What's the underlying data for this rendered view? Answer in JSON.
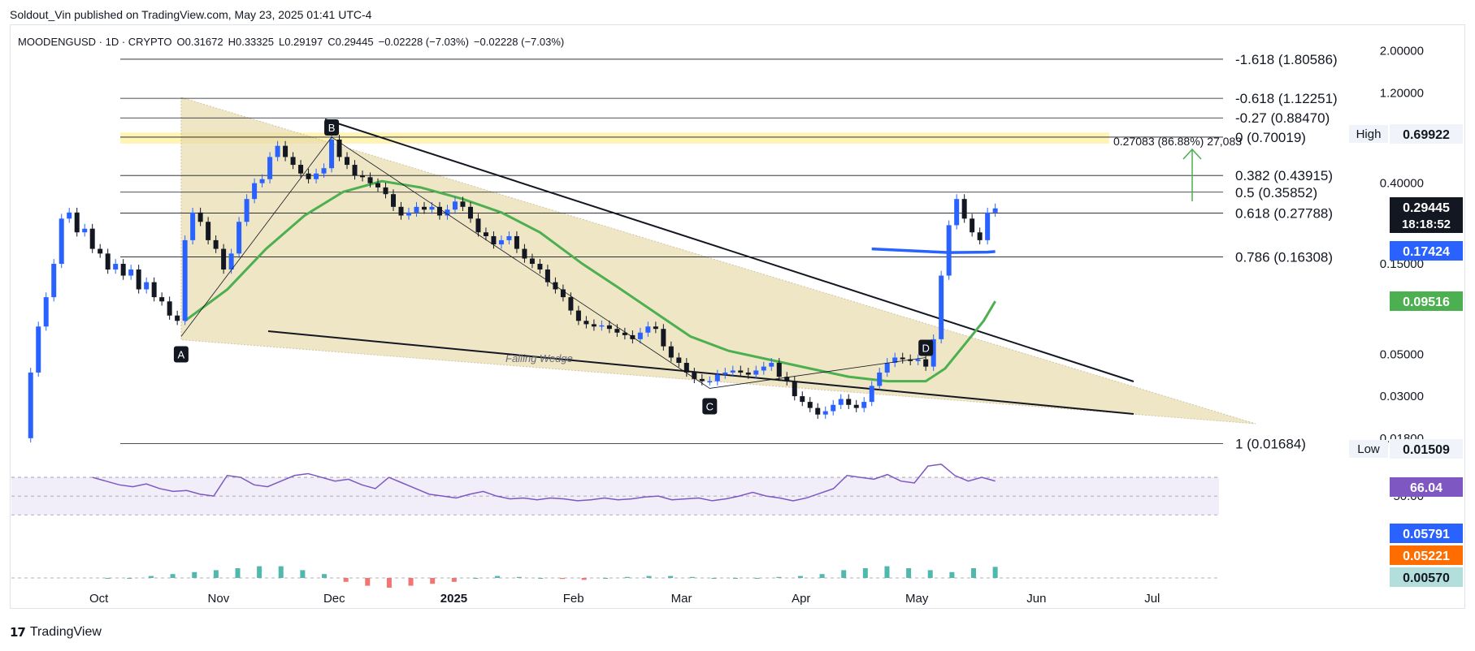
{
  "header": {
    "publisher_line": "Soldout_Vin published on TradingView.com, May 23, 2025 01:41 UTC-4"
  },
  "symbol_bar": {
    "symbol": "MOODENGUSD · 1D · CRYPTO",
    "open": "O0.31672",
    "high": "H0.33325",
    "low": "L0.29197",
    "close": "C0.29445",
    "change": "−0.02228 (−7.03%)",
    "change2": "−0.02228 (−7.03%)"
  },
  "footer": {
    "brand": "TradingView"
  },
  "colors": {
    "up_candle": "#2962ff",
    "down_candle": "#131722",
    "wedge_fill": "#e8d9a8",
    "ema_green": "#4caf50",
    "ema_blue": "#2962ff",
    "rsi_line": "#7e57c2",
    "macd_line": "#2962ff",
    "signal_line": "#ff6d00",
    "highlight_band": "#fff2a8"
  },
  "chart_data": [
    {
      "type": "candlestick",
      "scale": "log",
      "y_tick_labels": [
        "2.00000",
        "1.20000",
        "0.40000",
        "0.15000",
        "0.05000",
        "0.03000",
        "0.01800"
      ],
      "x_tick_labels": [
        "Oct",
        "Nov",
        "Dec",
        "2025",
        "Feb",
        "Mar",
        "Apr",
        "May",
        "Jun",
        "Jul"
      ],
      "ylim": [
        0.0155,
        2.5
      ],
      "fibonacci_levels": [
        {
          "label": "-1.618 (1.80586)",
          "value": 1.80586
        },
        {
          "label": "-0.618 (1.12251)",
          "value": 1.12251
        },
        {
          "label": "-0.27 (0.88470)",
          "value": 0.8847
        },
        {
          "label": "0 (0.70019)",
          "value": 0.70019
        },
        {
          "label": "0.382 (0.43915)",
          "value": 0.43915
        },
        {
          "label": "0.5 (0.35852)",
          "value": 0.35852
        },
        {
          "label": "0.618 (0.27788)",
          "value": 0.27788
        },
        {
          "label": "0.786 (0.16308)",
          "value": 0.16308
        },
        {
          "label": "1 (0.01684)",
          "value": 0.01684
        }
      ],
      "target_label": "0.27083 (86.88%) 27,083",
      "pattern_points": [
        {
          "label": "A",
          "date": "2024-10-24",
          "value": 0.062
        },
        {
          "label": "B",
          "date": "2024-12-02",
          "value": 0.7
        },
        {
          "label": "C",
          "date": "2025-03-10",
          "value": 0.033
        },
        {
          "label": "D",
          "date": "2025-05-05",
          "value": 0.048
        }
      ],
      "annotation": "Falling Wedge",
      "price_badges": [
        {
          "label": "High",
          "value": "0.69922"
        },
        {
          "label": "Low",
          "value": "0.01509"
        },
        {
          "label": "last",
          "value": "0.29445",
          "countdown": "18:18:52"
        },
        {
          "label": "ema_blue",
          "value": "0.17424"
        },
        {
          "label": "ema_green",
          "value": "0.09516"
        }
      ],
      "close_series": [
        [
          "2024-09-13",
          0.018
        ],
        [
          "2024-09-15",
          0.04
        ],
        [
          "2024-09-17",
          0.07
        ],
        [
          "2024-09-19",
          0.1
        ],
        [
          "2024-09-21",
          0.15
        ],
        [
          "2024-09-23",
          0.26
        ],
        [
          "2024-09-25",
          0.28
        ],
        [
          "2024-09-27",
          0.22
        ],
        [
          "2024-09-29",
          0.23
        ],
        [
          "2024-10-01",
          0.18
        ],
        [
          "2024-10-03",
          0.17
        ],
        [
          "2024-10-05",
          0.14
        ],
        [
          "2024-10-07",
          0.15
        ],
        [
          "2024-10-09",
          0.13
        ],
        [
          "2024-10-11",
          0.14
        ],
        [
          "2024-10-13",
          0.11
        ],
        [
          "2024-10-15",
          0.12
        ],
        [
          "2024-10-17",
          0.1
        ],
        [
          "2024-10-19",
          0.095
        ],
        [
          "2024-10-21",
          0.08
        ],
        [
          "2024-10-23",
          0.075
        ],
        [
          "2024-10-25",
          0.2
        ],
        [
          "2024-10-27",
          0.28
        ],
        [
          "2024-10-29",
          0.25
        ],
        [
          "2024-10-31",
          0.2
        ],
        [
          "2024-11-02",
          0.18
        ],
        [
          "2024-11-04",
          0.14
        ],
        [
          "2024-11-06",
          0.17
        ],
        [
          "2024-11-08",
          0.25
        ],
        [
          "2024-11-10",
          0.33
        ],
        [
          "2024-11-12",
          0.4
        ],
        [
          "2024-11-14",
          0.42
        ],
        [
          "2024-11-16",
          0.55
        ],
        [
          "2024-11-18",
          0.63
        ],
        [
          "2024-11-20",
          0.55
        ],
        [
          "2024-11-22",
          0.5
        ],
        [
          "2024-11-24",
          0.45
        ],
        [
          "2024-11-26",
          0.42
        ],
        [
          "2024-11-28",
          0.45
        ],
        [
          "2024-11-30",
          0.48
        ],
        [
          "2024-12-02",
          0.68
        ],
        [
          "2024-12-04",
          0.55
        ],
        [
          "2024-12-06",
          0.5
        ],
        [
          "2024-12-08",
          0.44
        ],
        [
          "2024-12-10",
          0.43
        ],
        [
          "2024-12-12",
          0.4
        ],
        [
          "2024-12-14",
          0.38
        ],
        [
          "2024-12-16",
          0.35
        ],
        [
          "2024-12-18",
          0.3
        ],
        [
          "2024-12-20",
          0.27
        ],
        [
          "2024-12-22",
          0.28
        ],
        [
          "2024-12-24",
          0.3
        ],
        [
          "2024-12-26",
          0.29
        ],
        [
          "2024-12-28",
          0.3
        ],
        [
          "2024-12-30",
          0.27
        ],
        [
          "2025-01-01",
          0.29
        ],
        [
          "2025-01-03",
          0.32
        ],
        [
          "2025-01-05",
          0.3
        ],
        [
          "2025-01-07",
          0.26
        ],
        [
          "2025-01-09",
          0.22
        ],
        [
          "2025-01-11",
          0.21
        ],
        [
          "2025-01-13",
          0.19
        ],
        [
          "2025-01-15",
          0.2
        ],
        [
          "2025-01-17",
          0.21
        ],
        [
          "2025-01-19",
          0.18
        ],
        [
          "2025-01-21",
          0.16
        ],
        [
          "2025-01-23",
          0.15
        ],
        [
          "2025-01-25",
          0.14
        ],
        [
          "2025-01-27",
          0.12
        ],
        [
          "2025-01-29",
          0.11
        ],
        [
          "2025-01-31",
          0.1
        ],
        [
          "2025-02-02",
          0.085
        ],
        [
          "2025-02-04",
          0.075
        ],
        [
          "2025-02-06",
          0.072
        ],
        [
          "2025-02-08",
          0.07
        ],
        [
          "2025-02-10",
          0.071
        ],
        [
          "2025-02-12",
          0.068
        ],
        [
          "2025-02-14",
          0.065
        ],
        [
          "2025-02-16",
          0.063
        ],
        [
          "2025-02-18",
          0.06
        ],
        [
          "2025-02-20",
          0.065
        ],
        [
          "2025-02-22",
          0.07
        ],
        [
          "2025-02-24",
          0.068
        ],
        [
          "2025-02-26",
          0.055
        ],
        [
          "2025-02-28",
          0.048
        ],
        [
          "2025-03-02",
          0.045
        ],
        [
          "2025-03-04",
          0.04
        ],
        [
          "2025-03-06",
          0.037
        ],
        [
          "2025-03-08",
          0.036
        ],
        [
          "2025-03-10",
          0.036
        ],
        [
          "2025-03-12",
          0.039
        ],
        [
          "2025-03-14",
          0.04
        ],
        [
          "2025-03-16",
          0.041
        ],
        [
          "2025-03-18",
          0.04
        ],
        [
          "2025-03-20",
          0.039
        ],
        [
          "2025-03-22",
          0.041
        ],
        [
          "2025-03-24",
          0.043
        ],
        [
          "2025-03-26",
          0.045
        ],
        [
          "2025-03-28",
          0.038
        ],
        [
          "2025-03-30",
          0.036
        ],
        [
          "2025-04-01",
          0.03
        ],
        [
          "2025-04-03",
          0.028
        ],
        [
          "2025-04-05",
          0.026
        ],
        [
          "2025-04-07",
          0.024
        ],
        [
          "2025-04-09",
          0.025
        ],
        [
          "2025-04-11",
          0.027
        ],
        [
          "2025-04-13",
          0.029
        ],
        [
          "2025-04-15",
          0.027
        ],
        [
          "2025-04-17",
          0.026
        ],
        [
          "2025-04-19",
          0.028
        ],
        [
          "2025-04-21",
          0.034
        ],
        [
          "2025-04-23",
          0.04
        ],
        [
          "2025-04-25",
          0.045
        ],
        [
          "2025-04-27",
          0.048
        ],
        [
          "2025-04-29",
          0.047
        ],
        [
          "2025-05-01",
          0.046
        ],
        [
          "2025-05-03",
          0.047
        ],
        [
          "2025-05-05",
          0.043
        ],
        [
          "2025-05-07",
          0.06
        ],
        [
          "2025-05-09",
          0.13
        ],
        [
          "2025-05-11",
          0.24
        ],
        [
          "2025-05-13",
          0.33
        ],
        [
          "2025-05-15",
          0.26
        ],
        [
          "2025-05-17",
          0.22
        ],
        [
          "2025-05-19",
          0.2
        ],
        [
          "2025-05-21",
          0.28
        ],
        [
          "2025-05-23",
          0.29445
        ]
      ],
      "ema_green_series": [
        [
          "2024-10-25",
          0.075
        ],
        [
          "2024-11-05",
          0.11
        ],
        [
          "2024-11-15",
          0.18
        ],
        [
          "2024-11-25",
          0.27
        ],
        [
          "2024-12-05",
          0.36
        ],
        [
          "2024-12-15",
          0.41
        ],
        [
          "2024-12-25",
          0.38
        ],
        [
          "2025-01-05",
          0.33
        ],
        [
          "2025-01-15",
          0.28
        ],
        [
          "2025-01-25",
          0.22
        ],
        [
          "2025-02-05",
          0.15
        ],
        [
          "2025-02-15",
          0.11
        ],
        [
          "2025-02-25",
          0.08
        ],
        [
          "2025-03-05",
          0.062
        ],
        [
          "2025-03-15",
          0.052
        ],
        [
          "2025-03-25",
          0.047
        ],
        [
          "2025-04-05",
          0.042
        ],
        [
          "2025-04-15",
          0.038
        ],
        [
          "2025-04-25",
          0.036
        ],
        [
          "2025-05-05",
          0.036
        ],
        [
          "2025-05-10",
          0.042
        ],
        [
          "2025-05-15",
          0.056
        ],
        [
          "2025-05-20",
          0.075
        ],
        [
          "2025-05-23",
          0.09516
        ]
      ],
      "ema_blue_series": [
        [
          "2025-04-21",
          0.18
        ],
        [
          "2025-05-01",
          0.176
        ],
        [
          "2025-05-11",
          0.172
        ],
        [
          "2025-05-21",
          0.173
        ],
        [
          "2025-05-23",
          0.17424
        ]
      ]
    },
    {
      "type": "line",
      "name": "RSI",
      "y_tick_labels": [
        "50.00"
      ],
      "last_value": "66.04",
      "values": [
        70,
        66,
        62,
        60,
        63,
        58,
        55,
        56,
        52,
        50,
        72,
        70,
        62,
        60,
        66,
        72,
        74,
        70,
        66,
        68,
        62,
        58,
        70,
        64,
        58,
        52,
        50,
        48,
        52,
        55,
        50,
        47,
        48,
        46,
        48,
        47,
        45,
        46,
        48,
        46,
        47,
        49,
        50,
        46,
        47,
        48,
        45,
        47,
        50,
        54,
        50,
        48,
        45,
        48,
        53,
        58,
        72,
        70,
        68,
        73,
        66,
        64,
        82,
        84,
        72,
        66,
        70,
        66.04
      ]
    },
    {
      "type": "bar",
      "name": "MACD",
      "last_values": [
        "0.05791",
        "0.05221",
        "0.00570"
      ],
      "histogram": [
        0,
        0,
        0.001,
        0.002,
        0.003,
        0.004,
        0.005,
        0.006,
        0.006,
        0.004,
        0.002,
        -0.002,
        -0.004,
        -0.005,
        -0.004,
        -0.003,
        -0.002,
        0,
        0.001,
        0.0005,
        0,
        -0.0005,
        -0.001,
        0,
        0.0005,
        0.001,
        0.001,
        0.0005,
        0,
        0,
        0,
        0.0005,
        0.001,
        0.002,
        0.004,
        0.005,
        0.006,
        0.005,
        0.004,
        0.003,
        0.005,
        0.0057
      ]
    }
  ]
}
